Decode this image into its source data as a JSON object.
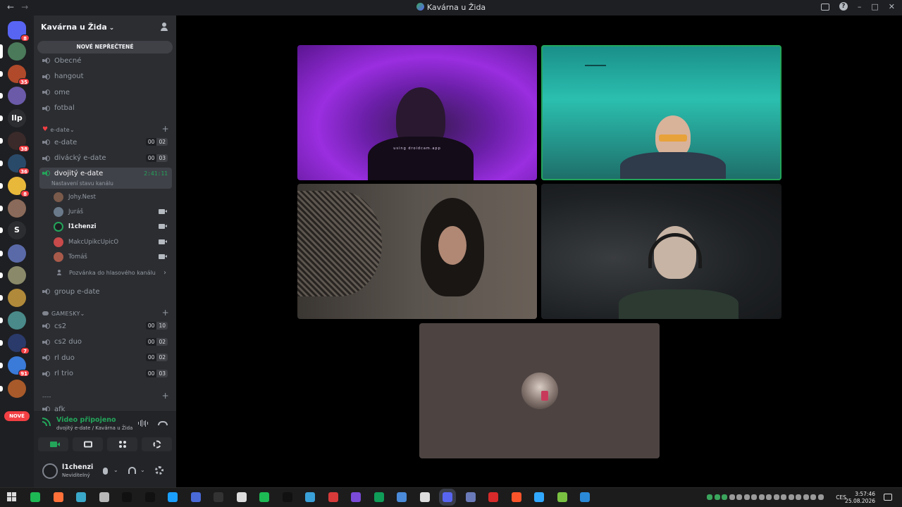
{
  "window": {
    "title": "Kavárna u Žida",
    "back": "←",
    "forward": "→"
  },
  "guilds": [
    {
      "badge": "8",
      "color": "#5865f2"
    },
    {
      "badge": "",
      "color": "#4a7a5a",
      "selected": true
    },
    {
      "badge": "35",
      "color": "#b04a2a"
    },
    {
      "badge": "",
      "color": "#6a5aa8"
    },
    {
      "badge": "",
      "text": "llp",
      "color": "#2b2d31"
    },
    {
      "badge": "38",
      "color": "#3a2a2a"
    },
    {
      "badge": "36",
      "color": "#2a4a6a"
    },
    {
      "badge": "8",
      "color": "#e8b83a"
    },
    {
      "badge": "",
      "color": "#8a6a5a"
    },
    {
      "badge": "",
      "text": "S",
      "color": "#2b2d31"
    },
    {
      "badge": "",
      "color": "#5a6aa8"
    },
    {
      "badge": "",
      "color": "#8a8a6a"
    },
    {
      "badge": "",
      "color": "#b08a3a"
    },
    {
      "badge": "",
      "color": "#4a8a8a"
    },
    {
      "badge": "7",
      "color": "#2a3a6a"
    },
    {
      "badge": "91",
      "color": "#3a7ad8"
    },
    {
      "badge": "",
      "color": "#a85a2a"
    }
  ],
  "new_pill": "NOVÉ",
  "server": {
    "name": "Kavárna u Žida",
    "new_unread": "NOVÉ NEPŘEČTENÉ"
  },
  "channels_top": [
    "Obecné",
    "hangout",
    "ome",
    "fotbal"
  ],
  "cat_edate": {
    "name": "e-date"
  },
  "edate_channels": [
    {
      "name": "e-date",
      "cnt": [
        "00",
        "02"
      ]
    },
    {
      "name": "divácký e-date",
      "cnt": [
        "00",
        "03"
      ]
    }
  ],
  "active_channel": {
    "name": "dvojitý e-date",
    "timer": "2:41:11",
    "status": "Nastavení stavu kanálu"
  },
  "voice_users": [
    {
      "name": "Johy.Nest",
      "cam": false,
      "color": "#7a5a4a"
    },
    {
      "name": "Juráš",
      "cam": true,
      "color": "#6a7a8a"
    },
    {
      "name": "l1chenzi",
      "cam": true,
      "color": "#1e1f22",
      "me": true
    },
    {
      "name": "MakcUpikcUpicO",
      "cam": true,
      "color": "#c84a4a"
    },
    {
      "name": "Tomáš",
      "cam": true,
      "color": "#a85a4a"
    }
  ],
  "invite": "Pozvánka do hlasového kanálu",
  "group_edate": "group e-date",
  "cat_gamesky": {
    "name": "GAMESKY"
  },
  "gamesky_channels": [
    {
      "name": "cs2",
      "cnt": [
        "00",
        "10"
      ]
    },
    {
      "name": "cs2 duo",
      "cnt": [
        "00",
        "02"
      ]
    },
    {
      "name": "rl duo",
      "cnt": [
        "00",
        "02"
      ]
    },
    {
      "name": "rl trio",
      "cnt": [
        "00",
        "03"
      ]
    }
  ],
  "cat_dashes": {
    "name": "----"
  },
  "afk": "afk",
  "voice_panel": {
    "status": "Video připojeno",
    "location": "dvojitý e-date / Kavárna u Žida"
  },
  "user": {
    "name": "l1chenzi",
    "status": "Neviditelný"
  },
  "video": {
    "watermark": "using droidcam.app"
  },
  "taskbar": {
    "lang": "CES",
    "time": "3:57:46",
    "date": "25.08.2026"
  },
  "taskbar_apps": [
    "#1db954",
    "#ff7139",
    "#3aa8c8",
    "#b8b8b8",
    "#111",
    "#111",
    "#1a9fff",
    "#4a6ad8",
    "#333",
    "#ddd",
    "#1db954",
    "#111",
    "#3aa0d8",
    "#d83a3a",
    "#7a4ad8",
    "#0f9d58",
    "#4a8ad8",
    "#ddd",
    "#5865f2",
    "#6a7ab8",
    "#d82a2a",
    "#fb542b",
    "#31a8ff",
    "#7ac142",
    "#2a8ad8"
  ]
}
